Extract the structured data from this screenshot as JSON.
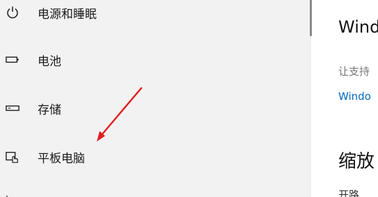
{
  "sidebar": {
    "items": [
      {
        "label": "电源和睡眠",
        "icon": "power-icon"
      },
      {
        "label": "电池",
        "icon": "battery-icon"
      },
      {
        "label": "存储",
        "icon": "storage-icon"
      },
      {
        "label": "平板电脑",
        "icon": "tablet-icon"
      }
    ]
  },
  "content": {
    "title": "Windc",
    "desc": "让支持",
    "link": "Windo",
    "heading": "缩放",
    "partial": "开路"
  },
  "colors": {
    "sidebar_bg": "#f2f2f2",
    "link": "#0067c0",
    "arrow": "#e02020"
  }
}
